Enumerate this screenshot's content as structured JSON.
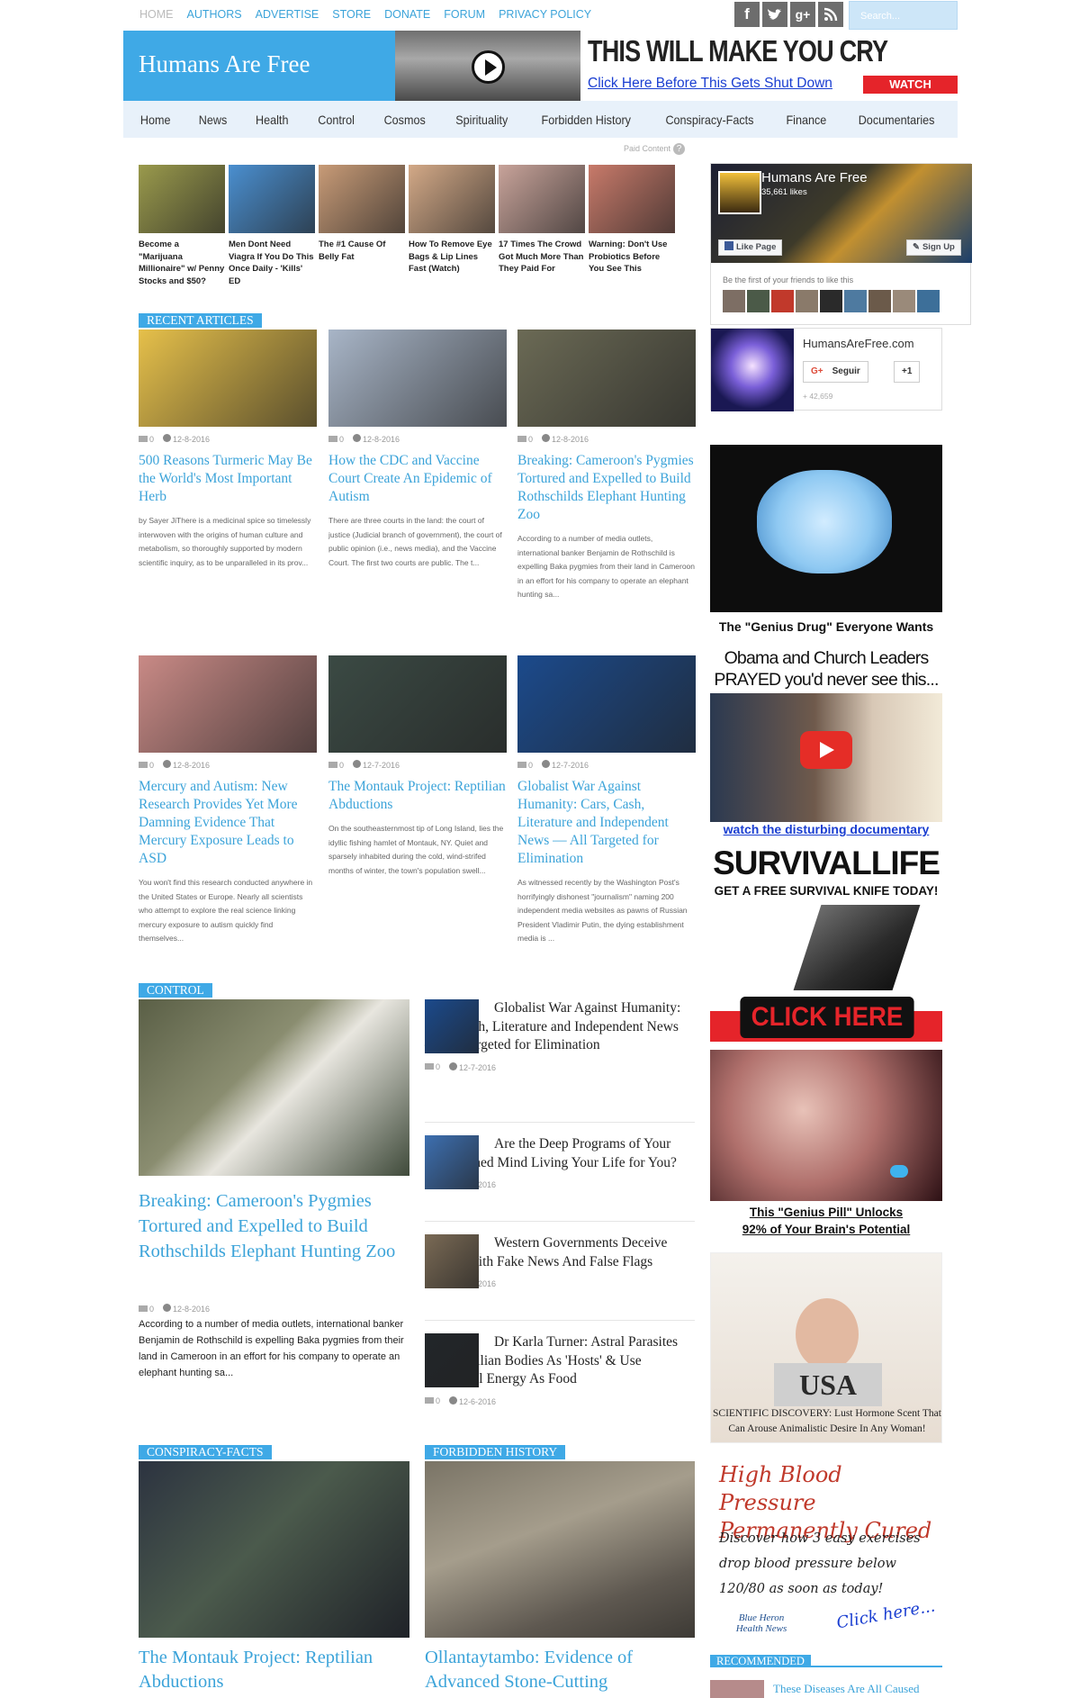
{
  "top_nav": [
    "HOME",
    "AUTHORS",
    "ADVERTISE",
    "STORE",
    "DONATE",
    "FORUM",
    "PRIVACY POLICY"
  ],
  "social_icons": [
    "facebook-icon",
    "twitter-icon",
    "google-plus-icon",
    "rss-icon"
  ],
  "search": {
    "placeholder": "Search..."
  },
  "site": {
    "title": "Humans Are Free"
  },
  "header_ad": {
    "headline": "THIS WILL MAKE YOU CRY",
    "link": "Click Here Before This Gets Shut Down",
    "button": "WATCH"
  },
  "main_nav": [
    "Home",
    "News",
    "Health",
    "Control",
    "Cosmos",
    "Spirituality",
    "Forbidden History",
    "Conspiracy-Facts",
    "Finance",
    "Documentaries"
  ],
  "paid_content": {
    "label": "Paid Content",
    "icon": "?"
  },
  "sponsored": [
    {
      "text": "Become a \"Marijuana Millionaire\" w/ Penny Stocks and $50?",
      "color": "#9a9a4c"
    },
    {
      "text": "Men Dont Need Viagra If You Do This Once Daily - 'Kills' ED",
      "color": "#4a8fd0"
    },
    {
      "text": "The #1 Cause Of Belly Fat",
      "color": "#c89b77"
    },
    {
      "text": "How To Remove Eye Bags & Lip Lines Fast (Watch)",
      "color": "#d3a987"
    },
    {
      "text": "17 Times The Crowd Got Much More Than They Paid For",
      "color": "#c8a39a"
    },
    {
      "text": "Warning: Don't Use Probiotics Before You See This",
      "color": "#c87a6a"
    }
  ],
  "recent": {
    "label": "RECENT ARTICLES",
    "articles": [
      {
        "comments": "0",
        "date": "12-8-2016",
        "title": "500 Reasons Turmeric May Be the World's Most Important Herb",
        "excerpt": "by Sayer JiThere is a medicinal spice so timelessly interwoven with the origins of human culture and metabolism, so thoroughly supported by modern scientific inquiry, as to be unparalleled in its prov...",
        "color": "#e6c04a"
      },
      {
        "comments": "0",
        "date": "12-8-2016",
        "title": "How the CDC and Vaccine Court Create An Epidemic of Autism",
        "excerpt": "There are three courts in the land: the court of justice (Judicial branch of government), the court of public opinion (i.e., news media), and the Vaccine Court. The first two courts are public. The t...",
        "color": "#a8b5c7"
      },
      {
        "comments": "0",
        "date": "12-8-2016",
        "title": "Breaking: Cameroon's Pygmies Tortured and Expelled to Build Rothschilds Elephant Hunting Zoo",
        "excerpt": "According to a number of media outlets, international banker Benjamin de Rothschild is expelling Baka pygmies from their land in Cameroon in an effort for his company to operate an elephant hunting sa...",
        "color": "#6b6a55"
      },
      {
        "comments": "0",
        "date": "12-8-2016",
        "title": "Mercury and Autism: New Research Provides Yet More Damning Evidence That Mercury Exposure Leads to ASD",
        "excerpt": "You won't find this research conducted anywhere in the United States or Europe. Nearly all scientists who attempt to explore the real science linking mercury exposure to autism quickly find themselves...",
        "color": "#c98a86"
      },
      {
        "comments": "0",
        "date": "12-7-2016",
        "title": "The Montauk Project: Reptilian Abductions",
        "excerpt": "On the southeasternmost tip of Long Island, lies the idyllic fishing hamlet of Montauk, NY. Quiet and sparsely inhabited during the cold, wind-strifed months of winter, the town's population swell...",
        "color": "#3b4a44"
      },
      {
        "comments": "0",
        "date": "12-7-2016",
        "title": "Globalist War Against Humanity: Cars, Cash, Literature and Independent News — All Targeted for Elimination",
        "excerpt": "As witnessed recently by the Washington Post's horrifyingly dishonest \"journalism\" naming 200 independent media websites as pawns of Russian President Vladimir Putin, the dying establishment media is ...",
        "color": "#1b4a8c"
      }
    ]
  },
  "control": {
    "label": "CONTROL",
    "feature": {
      "title": "Breaking: Cameroon's Pygmies Tortured and Expelled to Build Rothschilds Elephant Hunting Zoo",
      "comments": "0",
      "date": "12-8-2016",
      "excerpt": "According to a number of media outlets, international banker Benjamin de Rothschild is expelling Baka pygmies from their land in Cameroon in an effort for his company to operate an elephant hunting sa..."
    },
    "list": [
      {
        "title": "Globalist War Against Humanity: Cars, Cash, Literature and Independent News — All Targeted for Elimination",
        "comments": "0",
        "date": "12-7-2016",
        "color": "#1b4a8c"
      },
      {
        "title": "Are the Deep Programs of Your Conditioned Mind Living Your Life for You?",
        "comments": "0",
        "date": "12-7-2016",
        "color": "#3d6fb0"
      },
      {
        "title": "Western Governments Deceive People With Fake News And False Flags",
        "comments": "0",
        "date": "12-6-2016",
        "color": "#7a6a55"
      },
      {
        "title": "Dr Karla Turner: Astral Parasites Use Reptilian Bodies As 'Hosts' & Use Emotional Energy As Food",
        "comments": "0",
        "date": "12-6-2016",
        "color": "#22262a"
      }
    ]
  },
  "conspiracy": {
    "label": "CONSPIRACY-FACTS",
    "title": "The Montauk Project: Reptilian Abductions"
  },
  "forbidden": {
    "label": "FORBIDDEN HISTORY",
    "title": "Ollantaytambo: Evidence of Advanced Stone-Cutting"
  },
  "sidebar": {
    "facebook": {
      "name": "Humans Are Free",
      "likes": "35,661 likes",
      "like_button": "Like Page",
      "signup_button": "Sign Up",
      "friends_text": "Be the first of your friends to like this"
    },
    "gplus": {
      "name": "HumansAreFree.com",
      "follow": "Seguir",
      "plus_one": "+1",
      "count": "+ 42,659"
    },
    "ad1_caption": "The \"Genius Drug\" Everyone Wants",
    "ad2": {
      "headline": "Obama and Church Leaders PRAYED you'd never see this...",
      "link": "watch the disturbing documentary"
    },
    "ad3": {
      "brand": "SURVIVALLIFE",
      "sub": "GET A FREE SURVIVAL KNIFE TODAY!",
      "cta": "CLICK HERE"
    },
    "ad4": {
      "line1": "This \"Genius Pill\" Unlocks",
      "line2": "92% of Your Brain's Potential"
    },
    "ad5": {
      "shirt": "USA",
      "caption": "SCIENTIFIC DISCOVERY: Lust Hormone Scent That Can Arouse Animalistic Desire In Any Woman!"
    },
    "ad6": {
      "title": "High Blood Pressure Permanently Cured",
      "body": "Discover how 3 easy exercises drop blood pressure below 120/80 as soon as today!",
      "cta": "Click here...",
      "brand": "Blue Heron Health News"
    },
    "recommended_label": "RECOMMENDED",
    "recommended_first": "These Diseases Are All Caused"
  }
}
